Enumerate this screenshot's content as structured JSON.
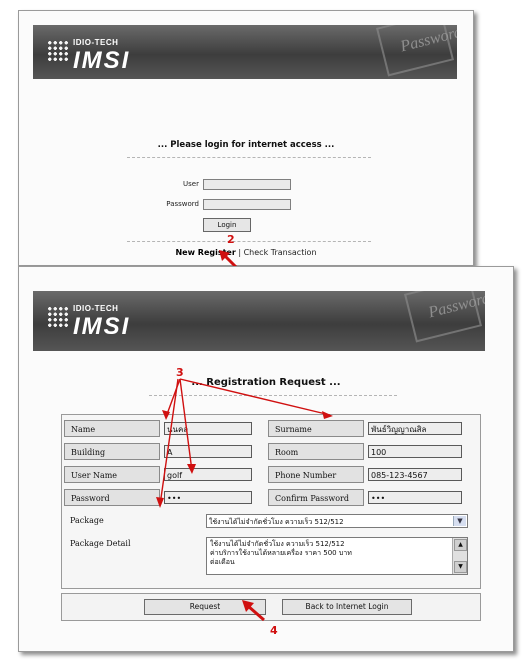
{
  "login_panel": {
    "brand_small": "IDIO-TECH",
    "brand_large": "IMSI",
    "watermark": "Password",
    "title": "... Please login for internet access ...",
    "user_label": "User",
    "password_label": "Password",
    "login_button": "Login",
    "new_register_link": "New Register",
    "separator": "|",
    "check_transaction_link": "Check Transaction"
  },
  "registration_panel": {
    "brand_small": "IDIO-TECH",
    "brand_large": "IMSI",
    "watermark": "Password",
    "title": "... Registration Request ...",
    "fields": {
      "name_label": "Name",
      "name_value": "นนคล",
      "surname_label": "Surname",
      "surname_value": "พันธ์วิญญาณสิล",
      "building_label": "Building",
      "building_value": "A",
      "room_label": "Room",
      "room_value": "100",
      "username_label": "User Name",
      "username_value": "golf",
      "phone_label": "Phone Number",
      "phone_value": "085-123-4567",
      "password_label": "Password",
      "password_value": "•••",
      "confirm_label": "Confirm Password",
      "confirm_value": "•••",
      "package_label": "Package",
      "package_value": "ใช้งานได้ไม่จำกัดชั่วโมง ความเร็ว 512/512",
      "package_detail_label": "Package Detail",
      "package_detail_line1": "ใช้งานได้ไม่จำกัดชั่วโมง ความเร็ว 512/512",
      "package_detail_line2": "ค่าบริการใช้งานได้หลายเครื่อง ราคา 500 บาท",
      "package_detail_line3": "ต่อเดือน"
    },
    "request_button": "Request",
    "back_button": "Back to Internet Login"
  },
  "annotations": {
    "step2": "2",
    "step3": "3",
    "step4": "4",
    "color": "#d01010"
  }
}
